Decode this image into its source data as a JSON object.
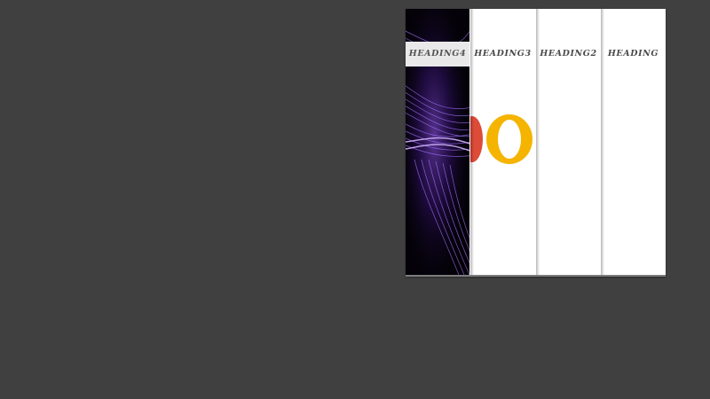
{
  "accordion": {
    "panels": [
      {
        "heading": "HEADING4",
        "image": "purple-light-waves-image",
        "active": true
      },
      {
        "heading": "HEADING3",
        "image": "colorful-logo-letters-image",
        "active": false
      },
      {
        "heading": "HEADING2",
        "image": "",
        "active": false
      },
      {
        "heading": "HEADING",
        "image": "",
        "active": false
      }
    ]
  },
  "colors": {
    "page_background": "#404040",
    "panel_background": "#ffffff",
    "active_heading_background": "#e9e9ea",
    "heading_text": "#4a4a4a",
    "logo_red": "#dd4b39",
    "logo_yellow": "#f4b400",
    "wave_purple": "#7b3cff"
  }
}
